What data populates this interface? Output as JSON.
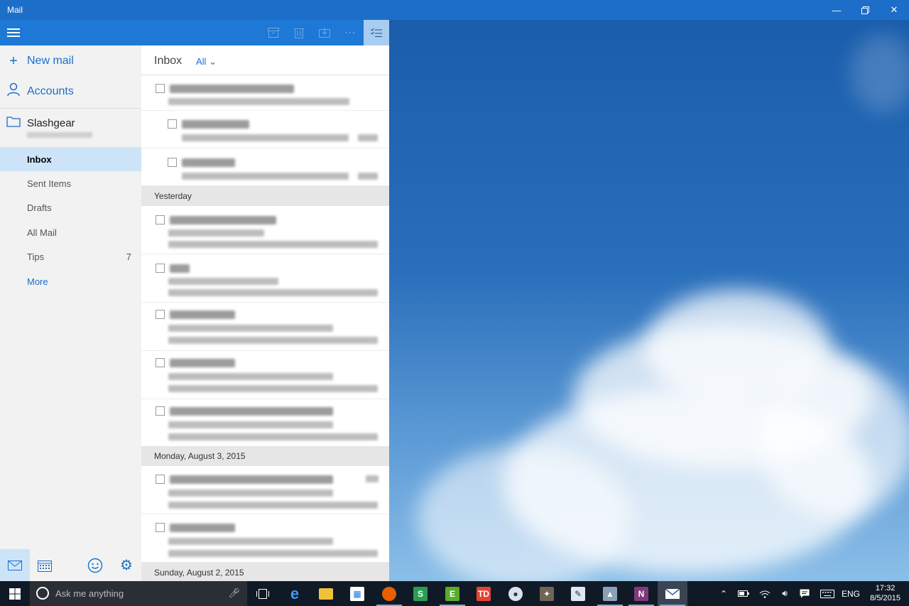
{
  "window": {
    "title": "Mail",
    "minimize_icon": "minimize-icon",
    "restore_icon": "restore-icon",
    "close_icon": "close-icon"
  },
  "nav": {
    "menu_icon": "hamburger-menu-icon",
    "new_mail": "New mail",
    "accounts": "Accounts",
    "account_name": "Slashgear",
    "folders": [
      {
        "label": "Inbox",
        "selected": true
      },
      {
        "label": "Sent Items"
      },
      {
        "label": "Drafts"
      },
      {
        "label": "All Mail"
      },
      {
        "label": "Tips",
        "count": "7"
      },
      {
        "label": "More"
      }
    ],
    "bottom_icons": [
      "mail-icon",
      "calendar-icon",
      "feedback-smiley-icon",
      "settings-gear-icon"
    ]
  },
  "list": {
    "toolbar_icons": [
      "archive-icon",
      "delete-icon",
      "move-icon",
      "more-icon",
      "select-mode-icon"
    ],
    "header": "Inbox",
    "filter": "All",
    "groups": [
      "Yesterday",
      "Monday, August 3, 2015",
      "Sunday, August 2, 2015"
    ]
  },
  "taskbar": {
    "search_placeholder": "Ask me anything",
    "apps": [
      "task-view-icon",
      "edge-icon",
      "file-explorer-icon",
      "store-icon",
      "firefox-icon",
      "sway-icon",
      "evernote-icon",
      "todoist-icon",
      "paint-icon",
      "gimp-icon",
      "notepad-icon",
      "remote-icon",
      "onenote-icon",
      "mail-app-icon"
    ],
    "language": "ENG",
    "time": "17:32",
    "date": "8/5/2015"
  },
  "colors": {
    "accent": "#1d78d6",
    "titlebar": "#1d6ec8",
    "selected_folder": "#cde4f8",
    "taskbar": "#101a26"
  }
}
